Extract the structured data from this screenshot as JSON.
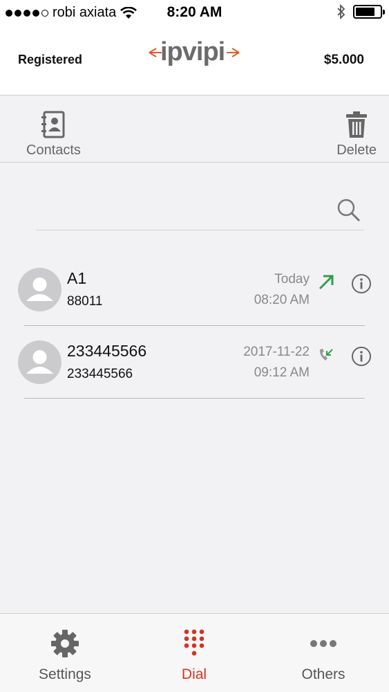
{
  "status_bar": {
    "carrier": "robi axiata",
    "time": "8:20 AM",
    "signal_bars": 4,
    "signal_total": 5,
    "battery_level": 0.8
  },
  "header": {
    "registration_status": "Registered",
    "logo": "ipvipi",
    "balance": "$5.000"
  },
  "toolbar": {
    "contacts_label": "Contacts",
    "delete_label": "Delete"
  },
  "calls": [
    {
      "name": "A1",
      "number": "88011",
      "date": "Today",
      "time": "08:20 AM",
      "type": "outgoing-call-icon"
    },
    {
      "name": "233445566",
      "number": "233445566",
      "date": "2017-11-22",
      "time": "09:12 AM",
      "type": "incoming-call-icon"
    }
  ],
  "tabs": {
    "settings_label": "Settings",
    "dial_label": "Dial",
    "others_label": "Others"
  },
  "colors": {
    "accent": "#d6331f",
    "outgoing": "#2e9e4a",
    "incoming": "#2e9e4a",
    "muted": "#888888"
  }
}
